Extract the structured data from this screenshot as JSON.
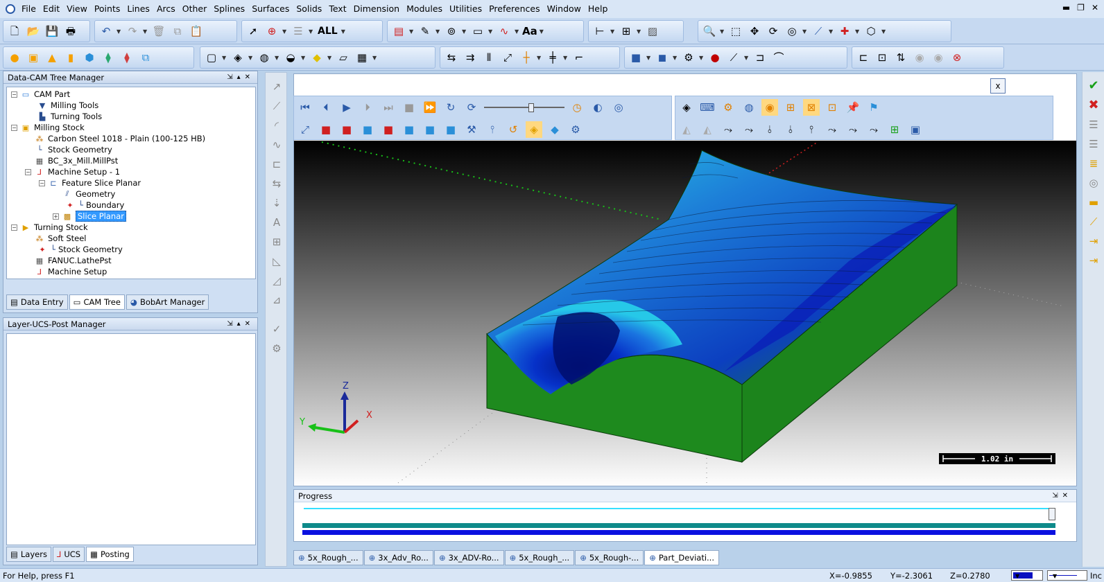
{
  "menu": [
    "File",
    "Edit",
    "View",
    "Points",
    "Lines",
    "Arcs",
    "Other",
    "Splines",
    "Surfaces",
    "Solids",
    "Text",
    "Dimension",
    "Modules",
    "Utilities",
    "Preferences",
    "Window",
    "Help"
  ],
  "toolbar": {
    "all_label": "ALL",
    "text_label": "Aa"
  },
  "tree_panel": {
    "title": "Data-CAM Tree Manager",
    "nodes": [
      {
        "label": "CAM Part",
        "icon": "folder-icon"
      },
      {
        "label": "Milling Tools",
        "icon": "mill-tool-icon"
      },
      {
        "label": "Turning Tools",
        "icon": "turn-tool-icon"
      },
      {
        "label": "Milling Stock",
        "icon": "stock-box-icon"
      },
      {
        "label": "Carbon Steel 1018 - Plain (100-125 HB)",
        "icon": "material-icon"
      },
      {
        "label": "Stock Geometry",
        "icon": "geometry-icon"
      },
      {
        "label": "BC_3x_Mill.MillPst",
        "icon": "post-icon"
      },
      {
        "label": "Machine Setup - 1",
        "icon": "axes-icon"
      },
      {
        "label": "Feature Slice Planar",
        "icon": "feature-icon"
      },
      {
        "label": "Geometry",
        "icon": "geometry-icon"
      },
      {
        "label": "Boundary",
        "icon": "boundary-icon"
      },
      {
        "label": "Slice Planar",
        "icon": "operation-icon"
      },
      {
        "label": "Turning Stock",
        "icon": "turn-stock-icon"
      },
      {
        "label": "Soft Steel",
        "icon": "material-icon"
      },
      {
        "label": "Stock Geometry",
        "icon": "geometry-icon"
      },
      {
        "label": "FANUC.LathePst",
        "icon": "post-icon"
      },
      {
        "label": "Machine Setup",
        "icon": "axes-icon"
      }
    ],
    "tabs": [
      "Data Entry",
      "CAM Tree",
      "BobArt Manager"
    ]
  },
  "layer_panel": {
    "title": "Layer-UCS-Post Manager",
    "tabs": [
      "Layers",
      "UCS",
      "Posting"
    ]
  },
  "viewport": {
    "close_label": "x",
    "scale_label": "1.02 in",
    "axis_x": "X",
    "axis_y": "Y",
    "axis_z": "Z"
  },
  "progress": {
    "title": "Progress",
    "value": 1.0
  },
  "doc_tabs": [
    "5x_Rough_...",
    "3x_Adv_Ro...",
    "3x_ADV-Ro...",
    "5x_Rough_...",
    "5x_Rough-...",
    "Part_Deviati..."
  ],
  "status": {
    "help": "For Help, press F1",
    "x": "X=-0.9855",
    "y": "Y=-2.3061",
    "z": "Z=0.2780",
    "units": "Inc"
  },
  "colors": {
    "part_green": "#1a8a1a",
    "toolpath_blue": "#0a2fd0",
    "accent_cyan": "#35e0ff"
  }
}
